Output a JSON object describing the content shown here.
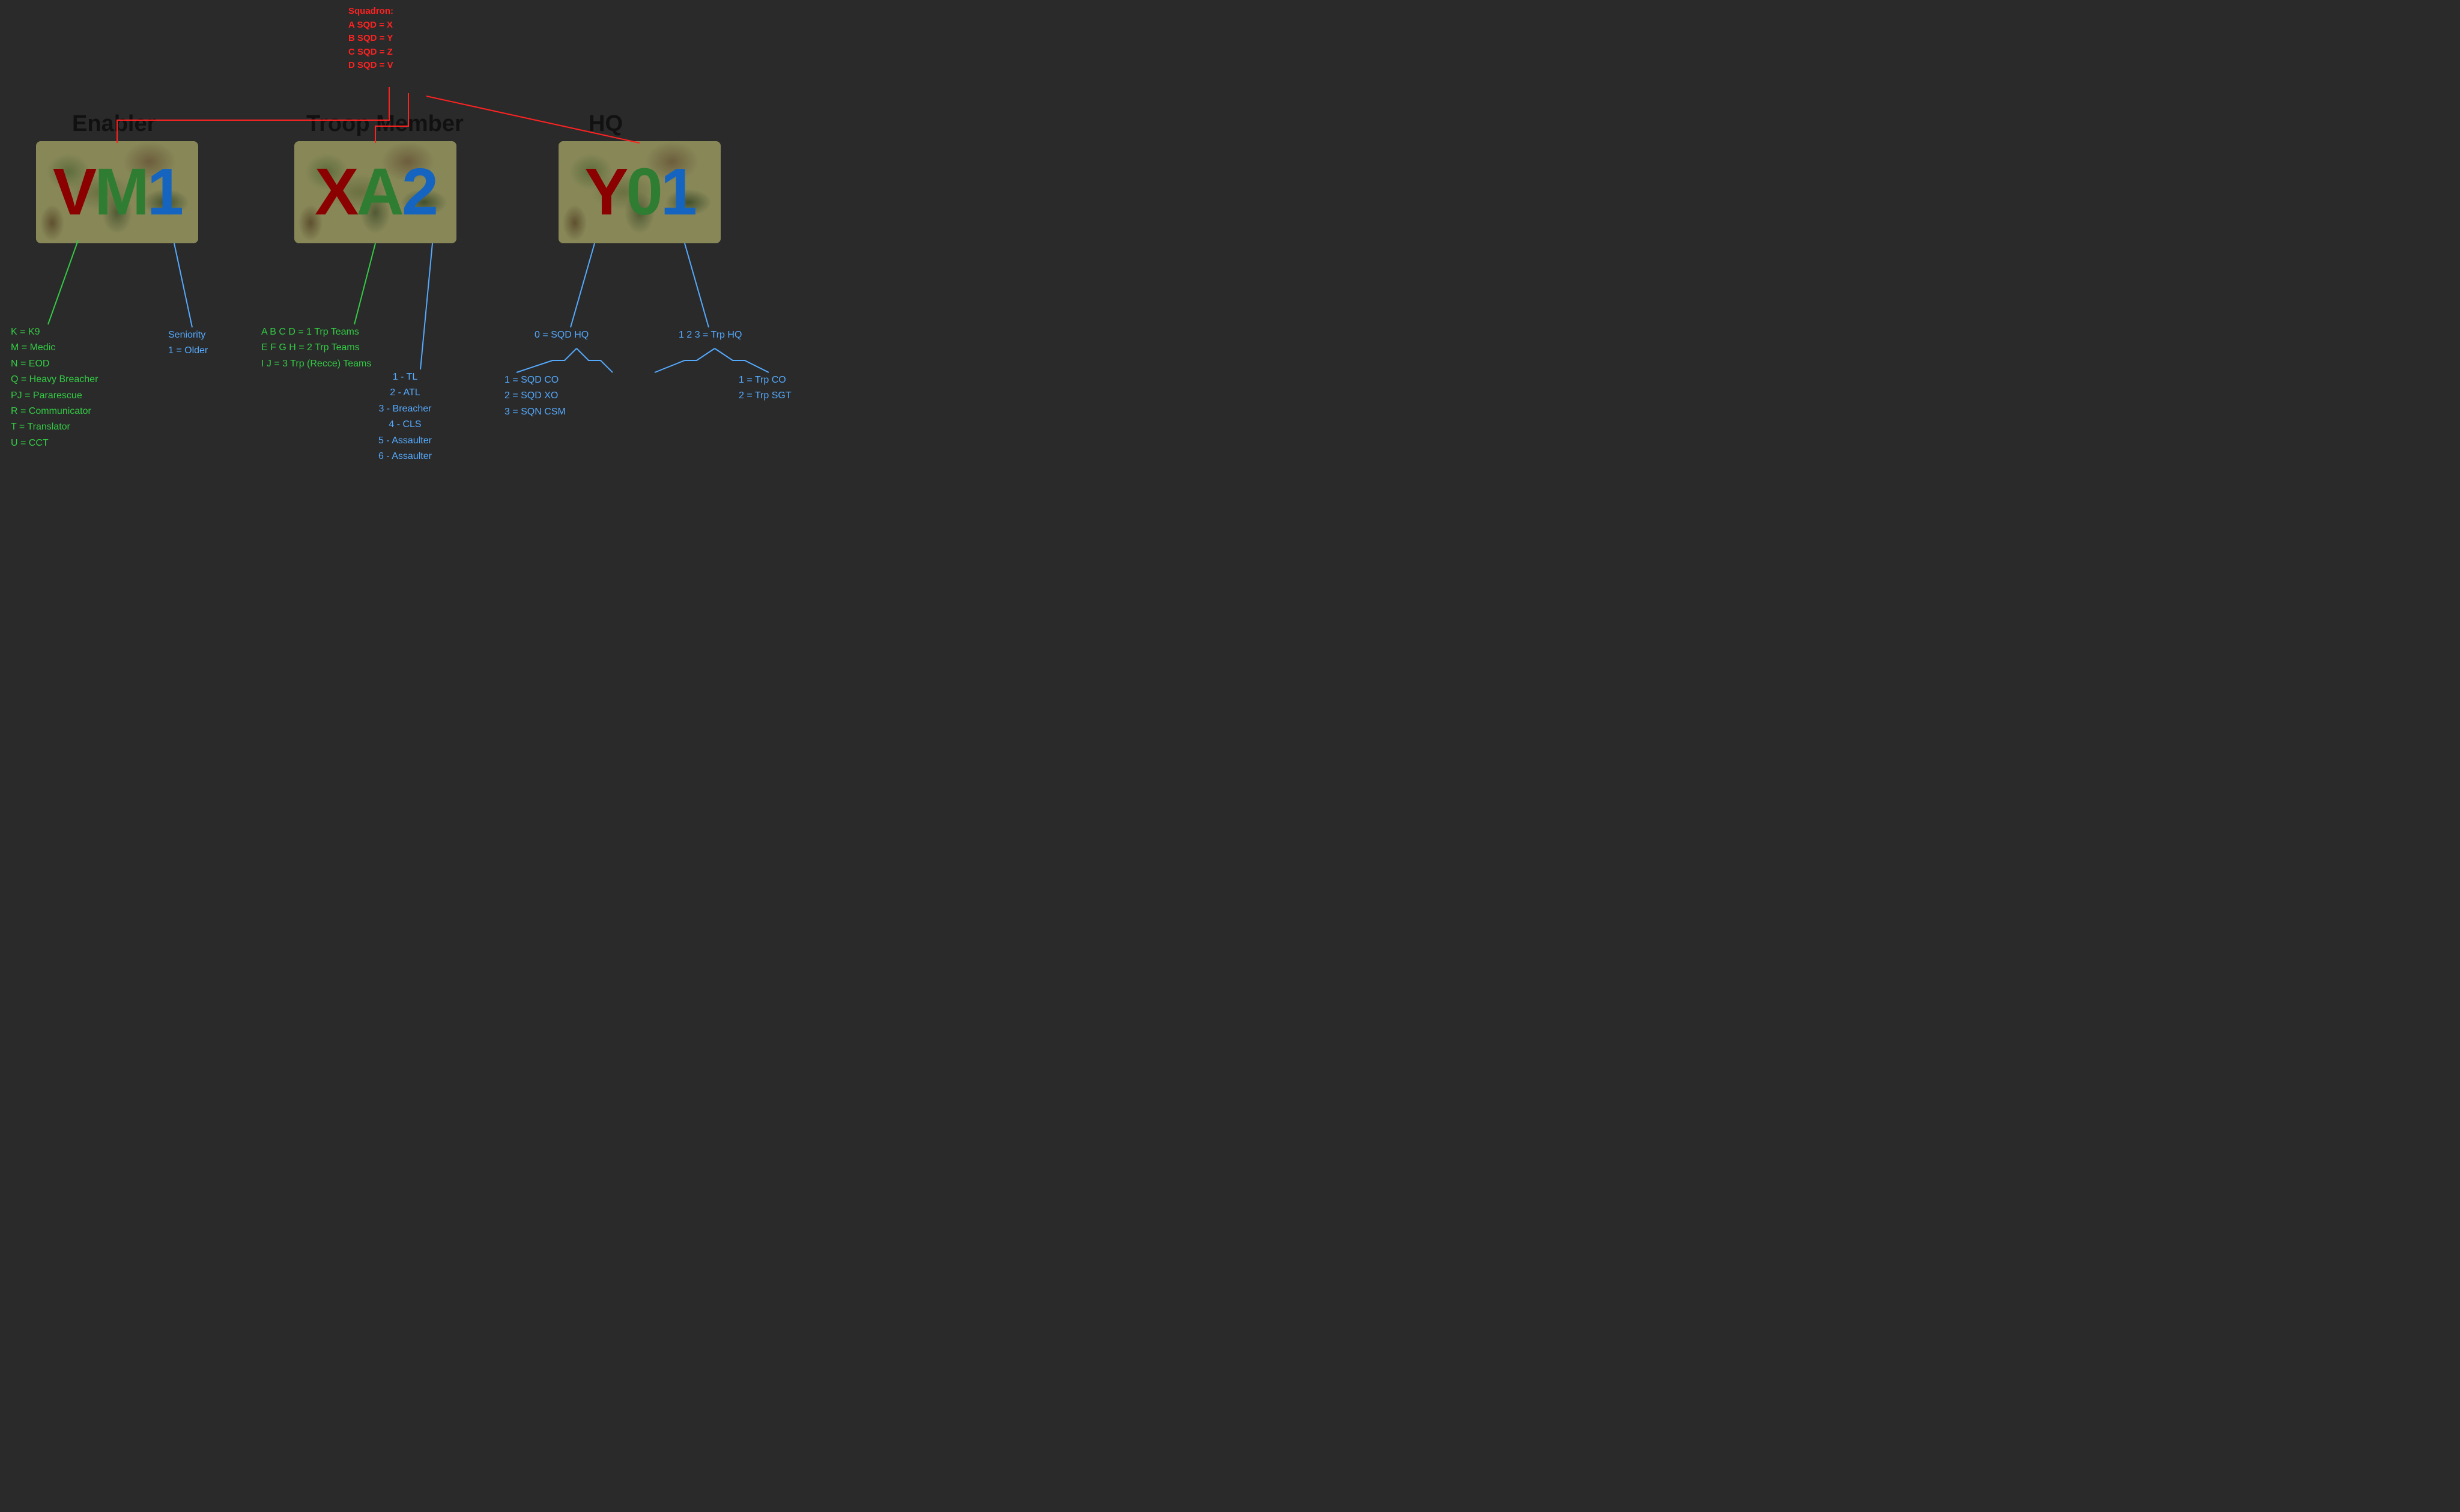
{
  "squadron": {
    "title": "Squadron:",
    "lines": [
      "A SQD = X",
      "B SQD = Y",
      "C SQD = Z",
      "D SQD = V"
    ]
  },
  "categories": {
    "enabler": {
      "label": "Enabler",
      "patch_code": "VM1",
      "letters": [
        {
          "char": "V",
          "color": "dark-red"
        },
        {
          "char": "M",
          "color": "green"
        },
        {
          "char": "1",
          "color": "blue"
        }
      ]
    },
    "troop": {
      "label": "Troop Member",
      "patch_code": "XA2",
      "letters": [
        {
          "char": "X",
          "color": "dark-red"
        },
        {
          "char": "A",
          "color": "green"
        },
        {
          "char": "2",
          "color": "blue"
        }
      ]
    },
    "hq": {
      "label": "HQ",
      "patch_code": "Y01",
      "letters": [
        {
          "char": "Y",
          "color": "dark-red"
        },
        {
          "char": "0",
          "color": "green"
        },
        {
          "char": "1",
          "color": "blue"
        }
      ]
    }
  },
  "annotations": {
    "enabler_roles": {
      "color": "green",
      "lines": [
        "K = K9",
        "M = Medic",
        "N = EOD",
        "Q = Heavy Breacher",
        "PJ = Pararescue",
        "R = Communicator",
        "T = Translator",
        "U = CCT"
      ]
    },
    "seniority": {
      "color": "blue",
      "lines": [
        "Seniority",
        "1 = Older"
      ]
    },
    "troop_teams": {
      "color": "green",
      "lines": [
        "A B C D = 1 Trp Teams",
        "E F G H = 2 Trp Teams",
        "I J = 3 Trp (Recce) Teams"
      ]
    },
    "troop_roles": {
      "color": "blue",
      "lines": [
        "1 - TL",
        "2 - ATL",
        "3 - Breacher",
        "4 - CLS",
        "5 - Assaulter",
        "6 - Assaulter"
      ]
    },
    "hq_sqd": {
      "color": "blue",
      "lines": [
        "0 = SQD HQ"
      ]
    },
    "hq_sqd_roles": {
      "color": "blue",
      "lines": [
        "1 = SQD CO",
        "2 = SQD XO",
        "3 = SQN CSM"
      ]
    },
    "hq_trp": {
      "color": "blue",
      "lines": [
        "1 2 3 = Trp HQ"
      ]
    },
    "hq_trp_roles": {
      "color": "blue",
      "lines": [
        "1 = Trp CO",
        "2 = Trp SGT"
      ]
    }
  },
  "colors": {
    "background": "#2a2a2a",
    "red_annotation": "#ff2222",
    "green_annotation": "#33cc44",
    "blue_annotation": "#55aaff"
  }
}
